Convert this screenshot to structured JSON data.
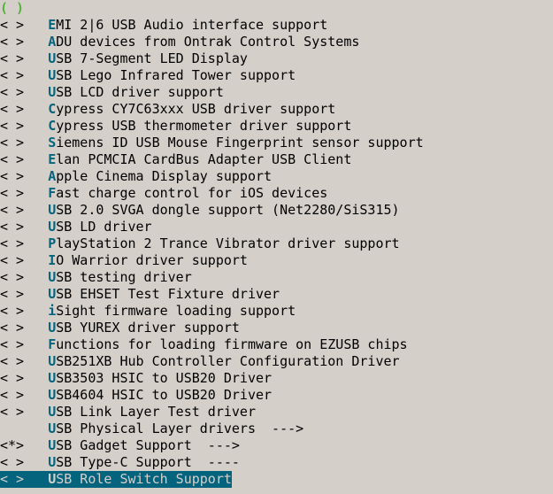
{
  "top_fragment": "( )",
  "items": [
    {
      "state": "< >",
      "hotkey": "E",
      "label": "MI 2|6 USB Audio interface support",
      "selected": false
    },
    {
      "state": "< >",
      "hotkey": "A",
      "label": "DU devices from Ontrak Control Systems",
      "selected": false
    },
    {
      "state": "< >",
      "hotkey": "U",
      "label": "SB 7-Segment LED Display",
      "selected": false
    },
    {
      "state": "< >",
      "hotkey": "U",
      "label": "SB Lego Infrared Tower support",
      "selected": false
    },
    {
      "state": "< >",
      "hotkey": "U",
      "label": "SB LCD driver support",
      "selected": false
    },
    {
      "state": "< >",
      "hotkey": "C",
      "label": "ypress CY7C63xxx USB driver support",
      "selected": false
    },
    {
      "state": "< >",
      "hotkey": "C",
      "label": "ypress USB thermometer driver support",
      "selected": false
    },
    {
      "state": "< >",
      "hotkey": "S",
      "label": "iemens ID USB Mouse Fingerprint sensor support",
      "selected": false
    },
    {
      "state": "< >",
      "hotkey": "E",
      "label": "lan PCMCIA CardBus Adapter USB Client",
      "selected": false
    },
    {
      "state": "< >",
      "hotkey": "A",
      "label": "pple Cinema Display support",
      "selected": false
    },
    {
      "state": "< >",
      "hotkey": "F",
      "label": "ast charge control for iOS devices",
      "selected": false
    },
    {
      "state": "< >",
      "hotkey": "U",
      "label": "SB 2.0 SVGA dongle support (Net2280/SiS315)",
      "selected": false
    },
    {
      "state": "< >",
      "hotkey": "U",
      "label": "SB LD driver",
      "selected": false
    },
    {
      "state": "< >",
      "hotkey": "P",
      "label": "layStation 2 Trance Vibrator driver support",
      "selected": false
    },
    {
      "state": "< >",
      "hotkey": "I",
      "label": "O Warrior driver support",
      "selected": false
    },
    {
      "state": "< >",
      "hotkey": "U",
      "label": "SB testing driver",
      "selected": false
    },
    {
      "state": "< >",
      "hotkey": "U",
      "label": "SB EHSET Test Fixture driver",
      "selected": false
    },
    {
      "state": "< >",
      "hotkey": "i",
      "label": "Sight firmware loading support",
      "selected": false
    },
    {
      "state": "< >",
      "hotkey": "U",
      "label": "SB YUREX driver support",
      "selected": false
    },
    {
      "state": "< >",
      "hotkey": "F",
      "label": "unctions for loading firmware on EZUSB chips",
      "selected": false
    },
    {
      "state": "< >",
      "hotkey": "U",
      "label": "SB251XB Hub Controller Configuration Driver",
      "selected": false
    },
    {
      "state": "< >",
      "hotkey": "U",
      "label": "SB3503 HSIC to USB20 Driver",
      "selected": false
    },
    {
      "state": "< >",
      "hotkey": "U",
      "label": "SB4604 HSIC to USB20 Driver",
      "selected": false
    },
    {
      "state": "< >",
      "hotkey": "U",
      "label": "SB Link Layer Test driver",
      "selected": false
    },
    {
      "state": "   ",
      "hotkey": "U",
      "label": "SB Physical Layer drivers  --->",
      "selected": false
    },
    {
      "state": "<*>",
      "hotkey": "U",
      "label": "SB Gadget Support  --->",
      "selected": false
    },
    {
      "state": "< >",
      "hotkey": "U",
      "label": "SB Type-C Support  ----",
      "selected": false
    },
    {
      "state": "< >",
      "hotkey": "U",
      "label": "SB Role Switch Support",
      "selected": true
    }
  ]
}
